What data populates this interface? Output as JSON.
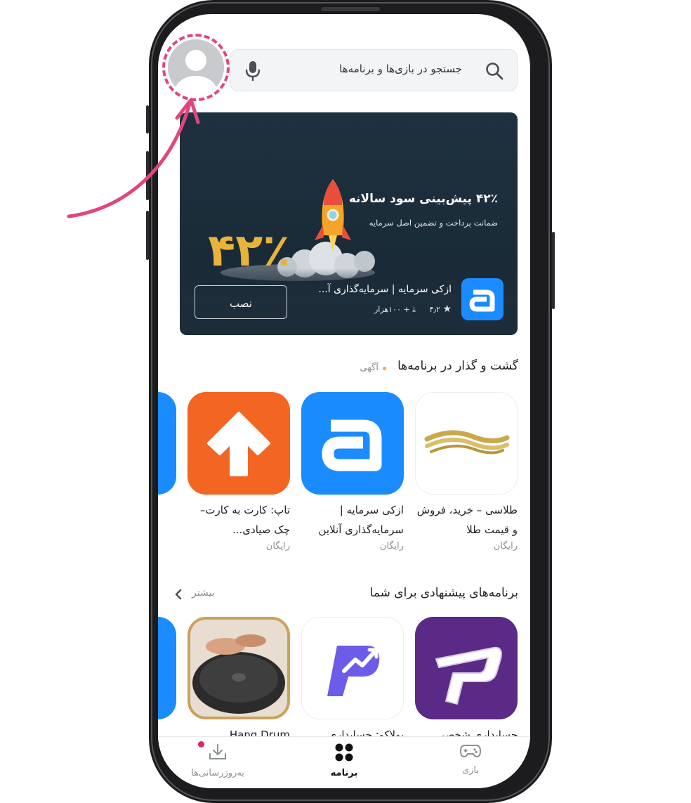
{
  "search": {
    "placeholder": "جستجو در بازی‌ها و برنامه‌ها",
    "icons": [
      "search-icon",
      "mic-icon"
    ]
  },
  "profile": {
    "icon": "avatar-icon"
  },
  "banner": {
    "headline": "۴۲٪ پیش‌بینی سود سالانه",
    "subline": "ضمانت پرداخت و تضمین اصل سرمایه",
    "big_number": "۴۲٪",
    "app_name": "ازکی سرمایه | سرمایه‌گذاری آ...",
    "rating": "۴٫۲",
    "downloads": "+ ۱۰۰هزار",
    "install_label": "نصب",
    "accent": "#1a8cff"
  },
  "section1": {
    "title": "گشت و گذار در برنامه‌ها",
    "ad_label": "آگهی",
    "ad_dot_color": "#f2a93b",
    "apps": [
      {
        "name": "طلاسی – خرید، فروش و قیمت طلا",
        "price": "رایگان"
      },
      {
        "name": "ازکی سرمایه | سرمایه‌گذاری آنلاین",
        "price": "رایگان"
      },
      {
        "name": "تاپ: کارت به کارت–چک صیادی...",
        "price": "رایگان"
      }
    ]
  },
  "section2": {
    "title": "برنامه‌های پیشنهادی برای شما",
    "more_label": "بیشتر",
    "apps": [
      {
        "name": "حسابداری شخصی"
      },
      {
        "name": "پولاکو: حسابداری"
      },
      {
        "name": "Hang Drum"
      }
    ]
  },
  "bottom_nav": {
    "items": [
      {
        "label": "بازی",
        "icon": "gamepad-icon",
        "active": false
      },
      {
        "label": "برنامه",
        "icon": "apps-grid-icon",
        "active": true
      },
      {
        "label": "به‌روزرسانی‌ها",
        "icon": "download-icon",
        "active": false
      }
    ],
    "badge_color": "#e0245e"
  },
  "colors": {
    "highlight": "#e0467c"
  }
}
